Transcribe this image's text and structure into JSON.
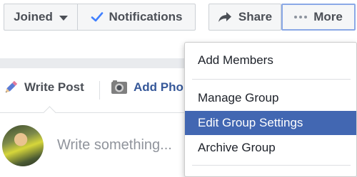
{
  "header": {
    "joined_label": "Joined",
    "notifications_label": "Notifications",
    "share_label": "Share",
    "more_label": "More"
  },
  "composer": {
    "write_post_label": "Write Post",
    "add_photo_label": "Add Pho",
    "placeholder": "Write something..."
  },
  "dropdown_menu": {
    "items": [
      {
        "label": "Add Members"
      },
      {
        "label": "Manage Group"
      },
      {
        "label": "Edit Group Settings",
        "highlighted": true
      },
      {
        "label": "Archive Group"
      }
    ]
  },
  "colors": {
    "accent": "#4267b2",
    "link": "#365899",
    "notification_check": "#4080ff",
    "button_border": "#ccd0d5",
    "focus_border": "#8aa8e6"
  },
  "icons": [
    "caret-down-icon",
    "check-icon",
    "share-arrow-icon",
    "more-dots-icon",
    "pencil-icon",
    "camera-icon"
  ]
}
